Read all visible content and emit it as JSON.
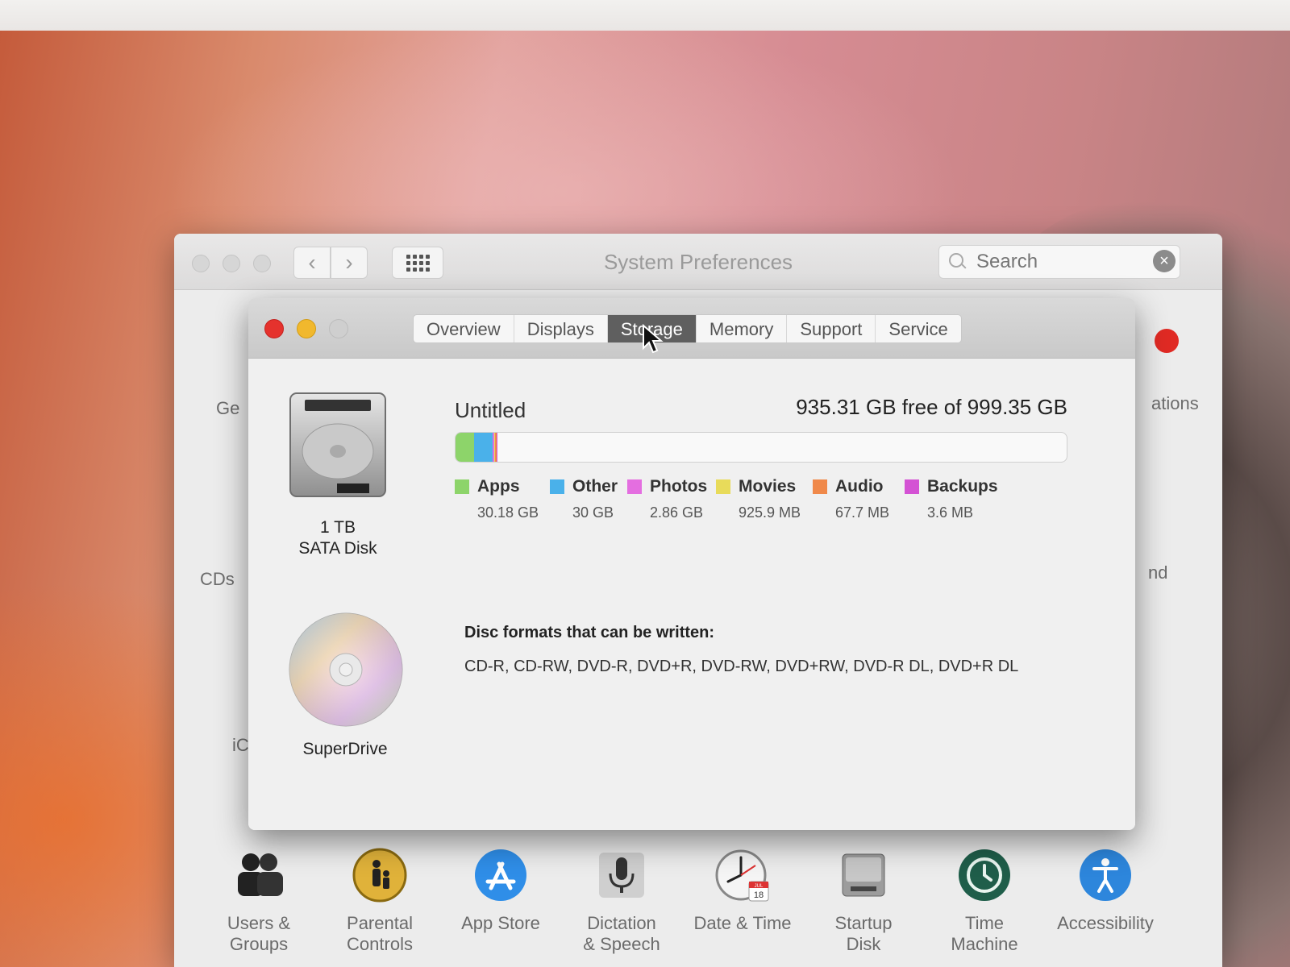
{
  "window": {
    "title": "System Preferences",
    "search_placeholder": "Search"
  },
  "peek_labels": {
    "left_top": "Ge",
    "left_mid": "CDs",
    "left_low": "iC",
    "right_top": "ations",
    "right_mid": "nd"
  },
  "about": {
    "tabs": [
      {
        "label": "Overview",
        "active": false
      },
      {
        "label": "Displays",
        "active": false
      },
      {
        "label": "Storage",
        "active": true
      },
      {
        "label": "Memory",
        "active": false
      },
      {
        "label": "Support",
        "active": false
      },
      {
        "label": "Service",
        "active": false
      }
    ],
    "disk": {
      "size": "1 TB",
      "type": "SATA Disk",
      "icon": "hard-disk-icon"
    },
    "volume": {
      "name": "Untitled",
      "free_text": "935.31 GB free of 999.35 GB"
    },
    "usage": [
      {
        "name": "Apps",
        "size": "30.18 GB",
        "color": "#8dd46a",
        "fraction": 0.0302
      },
      {
        "name": "Other",
        "size": "30 GB",
        "color": "#4ab1ea",
        "fraction": 0.03
      },
      {
        "name": "Photos",
        "size": "2.86 GB",
        "color": "#e46ee0",
        "fraction": 0.0029
      },
      {
        "name": "Movies",
        "size": "925.9 MB",
        "color": "#e8db5a",
        "fraction": 0.0009
      },
      {
        "name": "Audio",
        "size": "67.7 MB",
        "color": "#f0894a",
        "fraction": 0.0001
      },
      {
        "name": "Backups",
        "size": "3.6 MB",
        "color": "#d452d4",
        "fraction": 0.0001
      }
    ],
    "superdrive": {
      "label": "SuperDrive",
      "formats_title": "Disc formats that can be written:",
      "formats": "CD-R, CD-RW, DVD-R, DVD+R, DVD-RW, DVD+RW, DVD-R DL, DVD+R DL"
    }
  },
  "bottom_prefs": [
    {
      "label": "Users &\nGroups",
      "icon": "users-icon"
    },
    {
      "label": "Parental\nControls",
      "icon": "parental-controls-icon"
    },
    {
      "label": "App Store",
      "icon": "app-store-icon"
    },
    {
      "label": "Dictation\n& Speech",
      "icon": "microphone-icon"
    },
    {
      "label": "Date & Time",
      "icon": "clock-icon"
    },
    {
      "label": "Startup\nDisk",
      "icon": "startup-disk-icon"
    },
    {
      "label": "Time\nMachine",
      "icon": "time-machine-icon"
    },
    {
      "label": "Accessibility",
      "icon": "accessibility-icon"
    }
  ],
  "calendar_badge": {
    "month": "JUL",
    "day": "18"
  }
}
